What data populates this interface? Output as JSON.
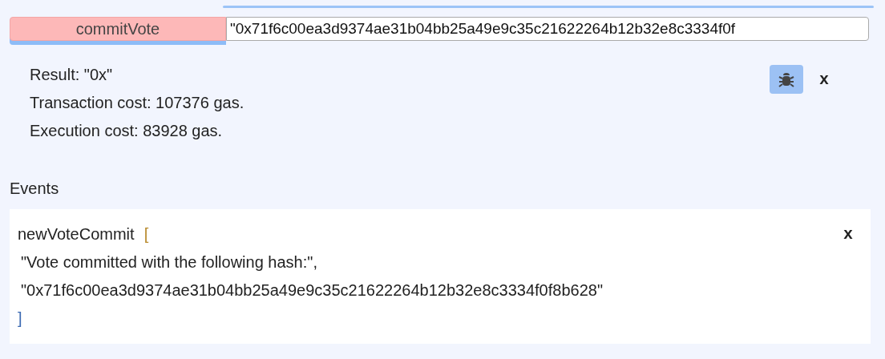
{
  "function_call": {
    "button": "commitVote",
    "value": "\"0x71f6c00ea3d9374ae31b04bb25a49e9c35c21622264b12b32e8c3334f0f"
  },
  "result": {
    "lines": [
      "Result: \"0x\"",
      "Transaction cost: 107376 gas.",
      "Execution cost: 83928 gas."
    ],
    "debug_selected": true,
    "close": "x"
  },
  "events": {
    "title": "Events",
    "items": [
      {
        "name": "newVoteCommit",
        "open": "[",
        "args": [
          "\"Vote committed with the following hash:\",",
          "\"0x71f6c00ea3d9374ae31b04bb25a49e9c35c21622264b12b32e8c3334f0f8b628\""
        ],
        "close_bracket": "]",
        "close": "x"
      }
    ]
  }
}
